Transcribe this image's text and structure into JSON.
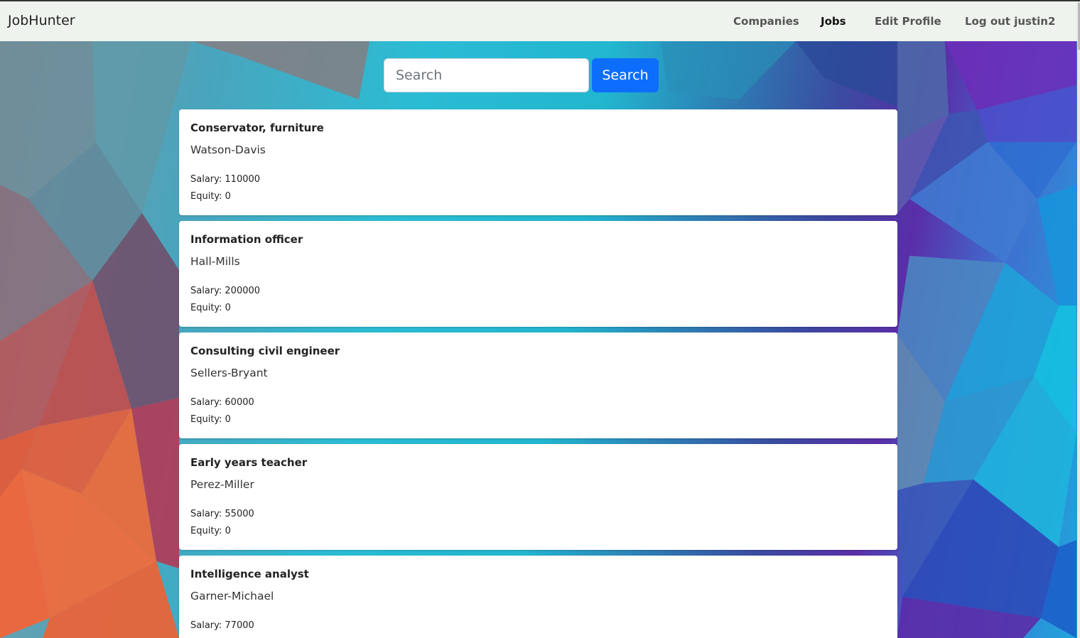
{
  "navbar": {
    "brand": "JobHunter",
    "links": [
      {
        "label": "Companies",
        "active": false
      },
      {
        "label": "Jobs",
        "active": true
      },
      {
        "label": "Edit Profile",
        "active": false
      },
      {
        "label": "Log out justin2",
        "active": false
      }
    ]
  },
  "search": {
    "placeholder": "Search",
    "value": "",
    "button_label": "Search"
  },
  "jobs": [
    {
      "title": "Conservator, furniture",
      "company": "Watson-Davis",
      "salary": "Salary: 110000",
      "equity": "Equity: 0"
    },
    {
      "title": "Information officer",
      "company": "Hall-Mills",
      "salary": "Salary: 200000",
      "equity": "Equity: 0"
    },
    {
      "title": "Consulting civil engineer",
      "company": "Sellers-Bryant",
      "salary": "Salary: 60000",
      "equity": "Equity: 0"
    },
    {
      "title": "Early years teacher",
      "company": "Perez-Miller",
      "salary": "Salary: 55000",
      "equity": "Equity: 0"
    },
    {
      "title": "Intelligence analyst",
      "company": "Garner-Michael",
      "salary": "Salary: 77000",
      "equity": ""
    }
  ],
  "colors": {
    "accent": "#0d6efd",
    "navbar_bg": "#eef3ee"
  }
}
